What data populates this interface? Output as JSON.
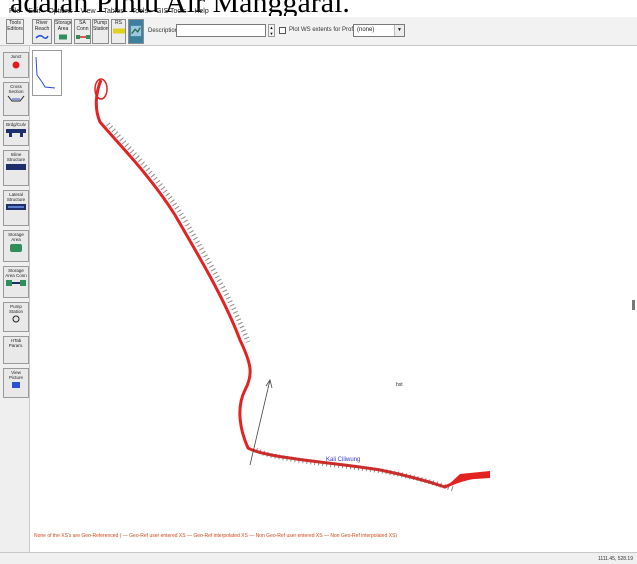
{
  "caption": {
    "text": "adalah Pintu Air Manggarai."
  },
  "menu": [
    "File",
    "Edit",
    "Options",
    "View",
    "Tables",
    "Tools",
    "GIS Tools",
    "Help"
  ],
  "toolbar": {
    "buttons": [
      {
        "label": "Tools Editors"
      },
      {
        "label": "River Reach"
      },
      {
        "label": "Storage Area"
      },
      {
        "label": "SA Conn"
      },
      {
        "label": "Pump Station"
      },
      {
        "label": "RS"
      }
    ],
    "description_label": "Description",
    "description_value": "",
    "plot_checkbox_label": "Plot WS extents for Profile",
    "profile_select": "(none)"
  },
  "left_tools": [
    {
      "label": "Junct"
    },
    {
      "label": "Cross Section"
    },
    {
      "label": "Brdg/Culv"
    },
    {
      "label": "Inline Structure"
    },
    {
      "label": "Lateral Structure"
    },
    {
      "label": "Storage Area"
    },
    {
      "label": "Storage Area Conn"
    },
    {
      "label": "Pump Station"
    },
    {
      "label": "HTab Param."
    },
    {
      "label": "View Picture"
    }
  ],
  "map": {
    "river_label": "Kali Ciliwung",
    "storage_label": "hst"
  },
  "legend": "None of the XS's are Geo-Referenced ( — Geo-Ref user entered XS — Geo-Ref interpolated XS — Non Geo-Ref user entered XS — Non Geo-Ref interpolated XS)",
  "status": {
    "coords": "1111.45, 528.19"
  },
  "colors": {
    "river": "#e32222",
    "accent_label": "#3535c8",
    "legend": "#d14a1e"
  }
}
